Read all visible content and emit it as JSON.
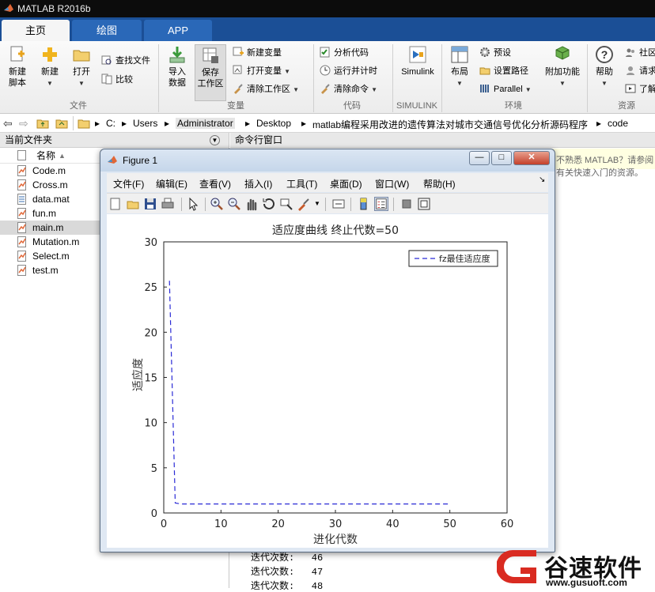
{
  "window": {
    "title": "MATLAB R2016b"
  },
  "tabs": [
    {
      "label": "主页"
    },
    {
      "label": "绘图"
    },
    {
      "label": "APP"
    }
  ],
  "ribbon": {
    "new_script": "新建\n脚本",
    "new": "新建",
    "open": "打开",
    "find_files": "查找文件",
    "compare": "比较",
    "import_data": "导入\n数据",
    "save_workspace": "保存\n工作区",
    "new_variable": "新建变量",
    "open_variable": "打开变量",
    "clear_workspace": "清除工作区",
    "analyze_code": "分析代码",
    "run_and_time": "运行并计时",
    "clear_commands": "清除命令",
    "simulink": "Simulink",
    "layout": "布局",
    "preferences": "预设",
    "set_path": "设置路径",
    "parallel": "Parallel",
    "add_ons": "附加功能",
    "help": "帮助",
    "community": "社区",
    "request_support": "请求",
    "learn": "了解",
    "groups": {
      "file": "文件",
      "variable": "变量",
      "code": "代码",
      "simulink": "SIMULINK",
      "environment": "环境",
      "resources": "资源"
    }
  },
  "address": {
    "crumbs": [
      "C:",
      "Users",
      "Administrator",
      "Desktop",
      "matlab编程采用改进的遗传算法对城市交通信号优化分析源码程序",
      "code"
    ]
  },
  "current_folder": {
    "title": "当前文件夹",
    "column_name": "名称",
    "files": [
      {
        "name": "Code.m"
      },
      {
        "name": "Cross.m"
      },
      {
        "name": "data.mat"
      },
      {
        "name": "fun.m"
      },
      {
        "name": "main.m"
      },
      {
        "name": "Mutation.m"
      },
      {
        "name": "Select.m"
      },
      {
        "name": "test.m"
      }
    ]
  },
  "command_window": {
    "title": "命令行窗口",
    "notice": "不熟悉 MATLAB？请参阅有关快速入门的资源。",
    "lines": [
      "迭代次数:   46",
      "迭代次数:   47",
      "迭代次数:   48"
    ]
  },
  "figure": {
    "title": "Figure 1",
    "menus": [
      "文件(F)",
      "编辑(E)",
      "查看(V)",
      "插入(I)",
      "工具(T)",
      "桌面(D)",
      "窗口(W)",
      "帮助(H)"
    ]
  },
  "chart_data": {
    "type": "line",
    "title": "适应度曲线  终止代数=50",
    "xlabel": "进化代数",
    "ylabel": "适应度",
    "xlim": [
      0,
      60
    ],
    "ylim": [
      0,
      30
    ],
    "xticks": [
      0,
      10,
      20,
      30,
      40,
      50,
      60
    ],
    "yticks": [
      0,
      5,
      10,
      15,
      20,
      25,
      30
    ],
    "legend_position": "top-right",
    "grid": false,
    "series": [
      {
        "name": "fz最佳适应度",
        "style": "dashed",
        "color": "#2b2bd6",
        "x": [
          1,
          2,
          3,
          4,
          5,
          6,
          7,
          8,
          9,
          10,
          11,
          12,
          13,
          14,
          15,
          16,
          17,
          18,
          19,
          20,
          21,
          22,
          23,
          24,
          25,
          26,
          27,
          28,
          29,
          30,
          31,
          32,
          33,
          34,
          35,
          36,
          37,
          38,
          39,
          40,
          41,
          42,
          43,
          44,
          45,
          46,
          47,
          48,
          49,
          50
        ],
        "y": [
          25.7,
          1.1,
          1.0,
          1.0,
          1.0,
          1.0,
          1.0,
          1.0,
          1.0,
          1.0,
          1.0,
          1.0,
          1.0,
          1.0,
          1.0,
          1.0,
          1.0,
          1.0,
          1.0,
          1.0,
          1.0,
          1.0,
          1.0,
          1.0,
          1.0,
          1.0,
          1.0,
          1.0,
          1.0,
          1.0,
          1.0,
          1.0,
          1.0,
          1.0,
          1.0,
          1.0,
          1.0,
          1.0,
          1.0,
          1.0,
          1.0,
          1.0,
          1.0,
          1.0,
          1.0,
          1.0,
          1.0,
          1.0,
          1.0,
          1.0
        ]
      }
    ]
  },
  "watermark": {
    "brand": "谷速软件",
    "url": "www.gusuoft.com"
  }
}
